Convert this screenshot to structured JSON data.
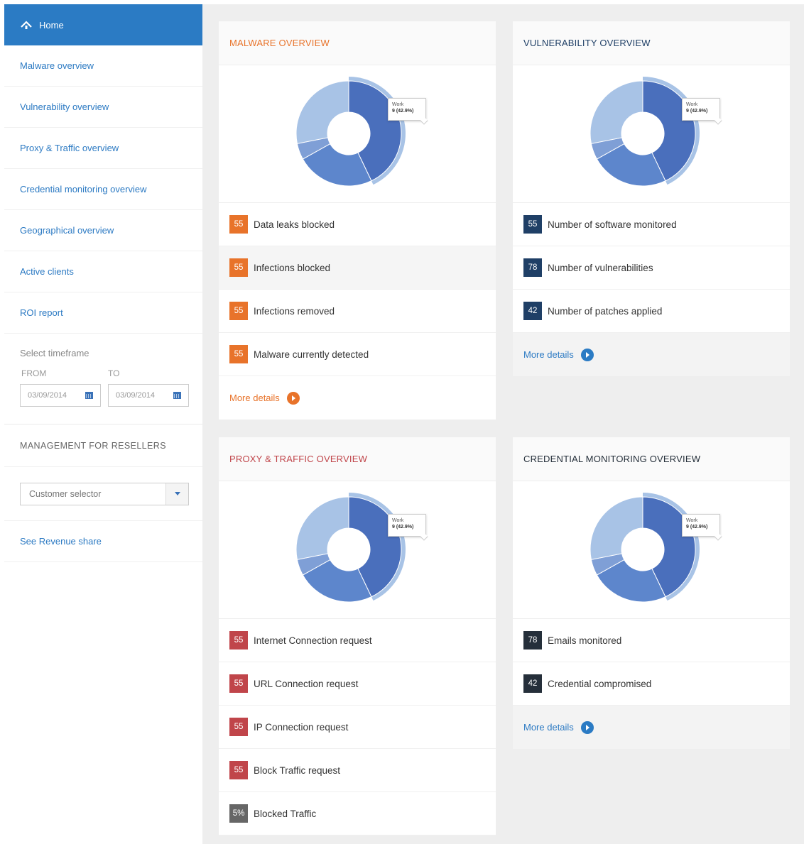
{
  "colors": {
    "home_bg": "#2b7bc4",
    "link": "#2c7ac3",
    "malware_accent": "#e8732a",
    "proxy_accent": "#c0454a",
    "vuln_badge": "#1f3f66",
    "cred_badge": "#252f3a",
    "blocked_badge": "#666666",
    "donut_dark": "#4a6fbc",
    "donut_mid": "#5d86cc",
    "donut_light": "#a8c3e6",
    "donut_small": "#7f9fd6"
  },
  "sidebar": {
    "home": {
      "label": "Home",
      "icon": "home-icon"
    },
    "items": [
      {
        "label": "Malware overview"
      },
      {
        "label": "Vulnerability overview"
      },
      {
        "label": "Proxy & Traffic overview"
      },
      {
        "label": "Credential monitoring overview"
      },
      {
        "label": "Geographical overview"
      },
      {
        "label": "Active clients"
      },
      {
        "label": "ROI report"
      }
    ],
    "timeframe": {
      "title": "Select timeframe",
      "from_label": "FROM",
      "to_label": "TO",
      "from_value": "03/09/2014",
      "to_value": "03/09/2014"
    },
    "management_title": "MANAGEMENT FOR RESELLERS",
    "customer_selector": "Customer selector",
    "revenue_link": "See Revenue share"
  },
  "tooltip": {
    "label": "Work",
    "value": "9 (42.9%)"
  },
  "chart_data": [
    {
      "type": "pie",
      "title": "",
      "values": [
        42.9,
        24,
        5,
        28.1
      ]
    },
    {
      "type": "pie",
      "title": "",
      "values": [
        42.9,
        24,
        5,
        28.1
      ]
    },
    {
      "type": "pie",
      "title": "",
      "values": [
        42.9,
        24,
        5,
        28.1
      ]
    },
    {
      "type": "pie",
      "title": "",
      "values": [
        42.9,
        24,
        5,
        28.1
      ]
    }
  ],
  "cards": {
    "malware": {
      "title": "MALWARE OVERVIEW",
      "rows": [
        {
          "count": "55",
          "label": "Data leaks blocked"
        },
        {
          "count": "55",
          "label": "Infections blocked"
        },
        {
          "count": "55",
          "label": "Infections removed"
        },
        {
          "count": "55",
          "label": "Malware currently detected"
        }
      ],
      "more": "More details"
    },
    "vulnerability": {
      "title": "VULNERABILITY OVERVIEW",
      "rows": [
        {
          "count": "55",
          "label": "Number of software monitored"
        },
        {
          "count": "78",
          "label": "Number of vulnerabilities"
        },
        {
          "count": "42",
          "label": "Number of patches applied"
        }
      ],
      "more": "More details"
    },
    "proxy": {
      "title": "PROXY & TRAFFIC OVERVIEW",
      "rows": [
        {
          "count": "55",
          "label": "Internet Connection request"
        },
        {
          "count": "55",
          "label": "URL Connection request"
        },
        {
          "count": "55",
          "label": "IP Connection request"
        },
        {
          "count": "55",
          "label": "Block Traffic request"
        },
        {
          "count": "5%",
          "label": "Blocked Traffic"
        }
      ]
    },
    "credential": {
      "title": "CREDENTIAL MONITORING OVERVIEW",
      "rows": [
        {
          "count": "78",
          "label": "Emails monitored"
        },
        {
          "count": "42",
          "label": "Credential compromised"
        }
      ],
      "more": "More details"
    }
  }
}
